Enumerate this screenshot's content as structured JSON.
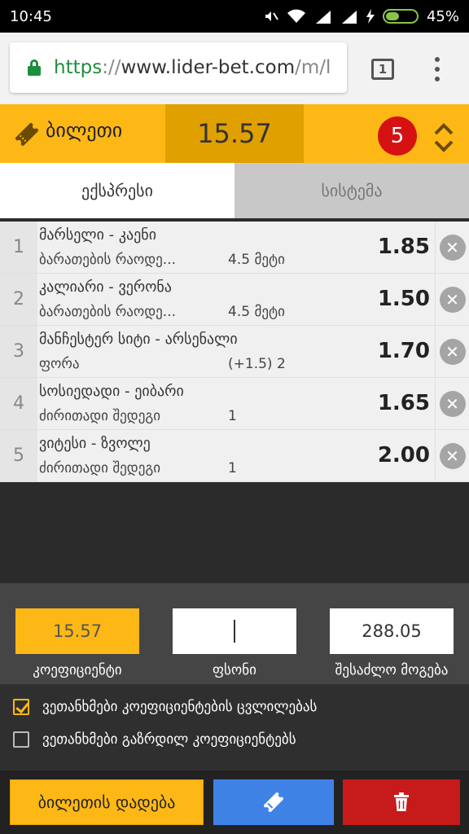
{
  "status_bar": {
    "time": "10:45",
    "battery": "45%",
    "battery_level": 0.45
  },
  "browser": {
    "url_scheme": "https",
    "url_sep": "://",
    "url_host": "www.lider-bet.com",
    "url_path": "/m/l",
    "tab_count": "1"
  },
  "ticket": {
    "label": "ბილეთი",
    "total_odds": "15.57",
    "selection_count": "5"
  },
  "tabs": [
    {
      "label": "ექსპრესი",
      "active": true
    },
    {
      "label": "სისტემა",
      "active": false
    }
  ],
  "bets": [
    {
      "num": "1",
      "teams": "მარსელი - კაენი",
      "market": "ბარათების რაოდე...",
      "outcome": "4.5 მეტი",
      "odds": "1.85"
    },
    {
      "num": "2",
      "teams": "კალიარი - ვერონა",
      "market": "ბარათების რაოდე...",
      "outcome": "4.5 მეტი",
      "odds": "1.50"
    },
    {
      "num": "3",
      "teams": "მანჩესტერ სიტი - არსენალი",
      "market": "ფორა",
      "outcome": "(+1.5) 2",
      "odds": "1.70"
    },
    {
      "num": "4",
      "teams": "სოსიედადი - ეიბარი",
      "market": "ძირითადი შედეგი",
      "outcome": "1",
      "odds": "1.65"
    },
    {
      "num": "5",
      "teams": "ვიტესი - ზვოლე",
      "market": "ძირითადი შედეგი",
      "outcome": "1",
      "odds": "2.00"
    }
  ],
  "summary": {
    "coefficient": "15.57",
    "coefficient_label": "კოეფიციენტი",
    "stake": "",
    "stake_label": "ფსონი",
    "possible_win": "288.05",
    "possible_win_label": "შესაძლო მოგება"
  },
  "options": [
    {
      "label": "ვეთანხმები კოეფიციენტების ცვლილებას",
      "checked": true
    },
    {
      "label": "ვეთანხმები გაზრდილ კოეფიციენტებს",
      "checked": false
    }
  ],
  "actions": {
    "place_label": "ბილეთის დადება"
  },
  "colors": {
    "accent": "#fdb815",
    "accent_dark": "#e0a000",
    "badge": "#d51111",
    "blue": "#3f82e6",
    "red": "#c71a1a"
  },
  "icons": {
    "ticket": "ticket-icon",
    "expand": "expand-collapse-icon",
    "remove": "remove-icon",
    "trash": "trash-icon",
    "lock": "lock-icon"
  }
}
